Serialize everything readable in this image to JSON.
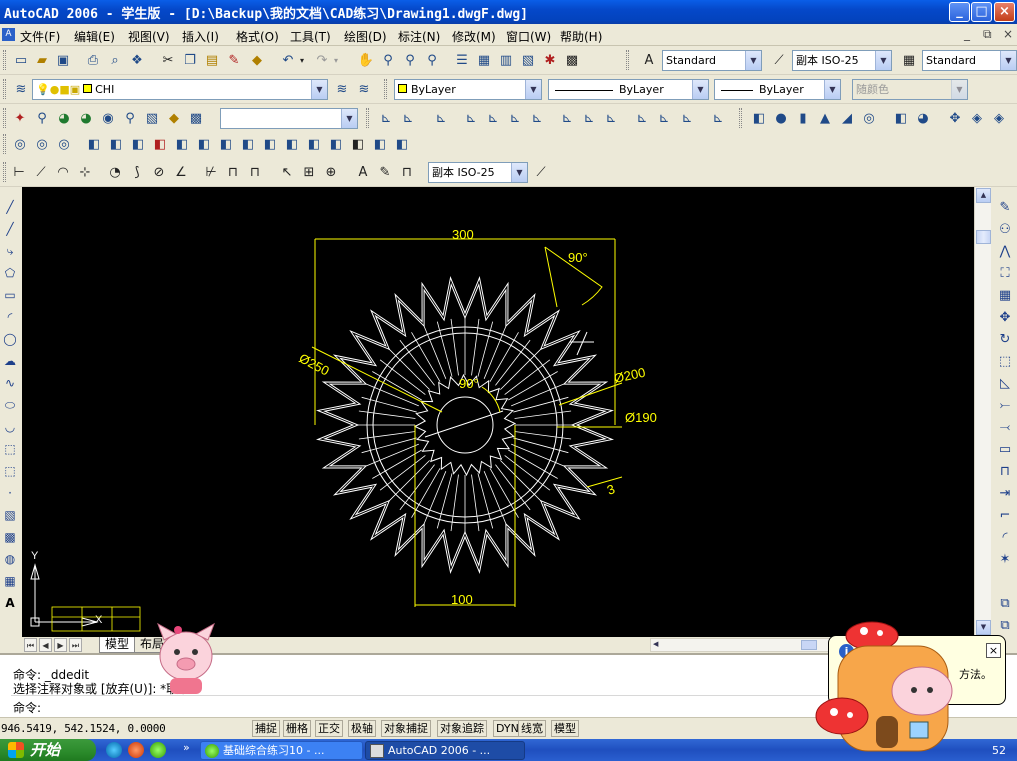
{
  "window": {
    "title": "AutoCAD 2006 - 学生版 - [D:\\Backup\\我的文档\\CAD练习\\Drawing1.dwgF.dwg]",
    "minimize": "_",
    "maximize": "□",
    "close": "×"
  },
  "menu": {
    "items": [
      "文件(F)",
      "编辑(E)",
      "视图(V)",
      "插入(I)",
      "格式(O)",
      "工具(T)",
      "绘图(D)",
      "标注(N)",
      "修改(M)",
      "窗口(W)",
      "帮助(H)"
    ],
    "doc_min": "_",
    "doc_restore": "⧉",
    "doc_close": "×"
  },
  "toolbar1": {
    "text_style": "Standard",
    "dim_style": "副本 ISO-25",
    "table_style": "Standard"
  },
  "toolbar2": {
    "layer": "CHI",
    "color": "ByLayer",
    "linetype": "ByLayer",
    "lineweight": "ByLayer",
    "plot_style": "随颜色"
  },
  "toolbar3": {
    "view_combo": ""
  },
  "toolbar5": {
    "dim_style": "副本 ISO-25"
  },
  "drawing": {
    "background": "#000000",
    "line_color": "#ffffff",
    "dim_color": "#ffff00",
    "dims": {
      "top_width": "300",
      "angle_top": "90°",
      "dia_250": "Ø250",
      "dia_200": "Ø200",
      "dia_190": "Ø190",
      "angle_inner": "90°",
      "small": "3",
      "bottom_width": "100"
    },
    "ucs_y": "Y",
    "ucs_x": "X"
  },
  "tabs": {
    "model": "模型",
    "layout": "布局"
  },
  "command": {
    "line1": "命令:  _ddedit",
    "line2": "选择注释对象或 [放弃(U)]: *取消*",
    "line3": "命令:"
  },
  "status": {
    "coords": "946.5419, 542.1524, 0.0000",
    "buttons": [
      "捕捉",
      "栅格",
      "正交",
      "极轴",
      "对象捕捉",
      "对象追踪",
      "DYN",
      "线宽",
      "模型"
    ]
  },
  "taskbar": {
    "start": "开始",
    "tasks": [
      "基础综合练习10 - ...",
      "AutoCAD 2006 - ..."
    ],
    "clock": "52"
  },
  "balloon": {
    "text": "方法。",
    "close": "×"
  }
}
